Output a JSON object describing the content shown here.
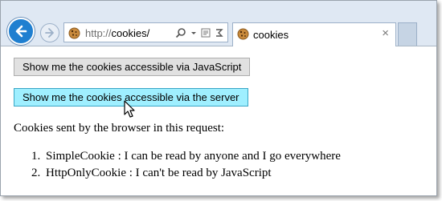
{
  "browser": {
    "address_scheme": "http://",
    "address_host": "cookies/",
    "tab_title": "cookies",
    "tab_close": "×",
    "icons": [
      "back-icon",
      "forward-icon",
      "cookie-favicon-icon",
      "search-icon",
      "dropdown-icon",
      "compatibility-view-icon",
      "refresh-icon",
      "close-icon"
    ],
    "accent": "#1f7fd0"
  },
  "page": {
    "button_js": "Show me the cookies accessible via JavaScript",
    "button_server": "Show me the cookies accessible via the server",
    "heading": "Cookies sent by the browser in this request:",
    "cookies": [
      {
        "num": "1.",
        "text": "SimpleCookie : I can be read by anyone and I go everywhere"
      },
      {
        "num": "2.",
        "text": "HttpOnlyCookie : I can't be read by JavaScript"
      }
    ],
    "hover_color": "#9fefff"
  }
}
